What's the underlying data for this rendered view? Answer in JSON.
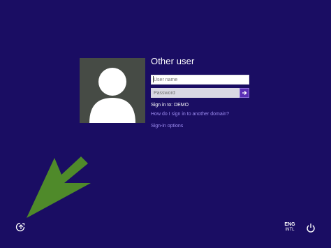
{
  "login": {
    "title": "Other user",
    "username_placeholder": "User name",
    "password_placeholder": "Password",
    "sign_in_to": "Sign in to: DEMO",
    "domain_link": "How do I sign in to another domain?",
    "options_link": "Sign-in options"
  },
  "footer": {
    "language_code": "ENG",
    "keyboard_layout": "INTL"
  },
  "icons": {
    "ease_of_access": "ease-of-access-icon",
    "power": "power-icon",
    "submit": "arrow-right-icon",
    "avatar": "user-silhouette-icon"
  },
  "colors": {
    "background": "#1a0d63",
    "accent": "#5b2fb5",
    "link": "#9c8bf0",
    "annotation_arrow": "#4f8a2a"
  }
}
